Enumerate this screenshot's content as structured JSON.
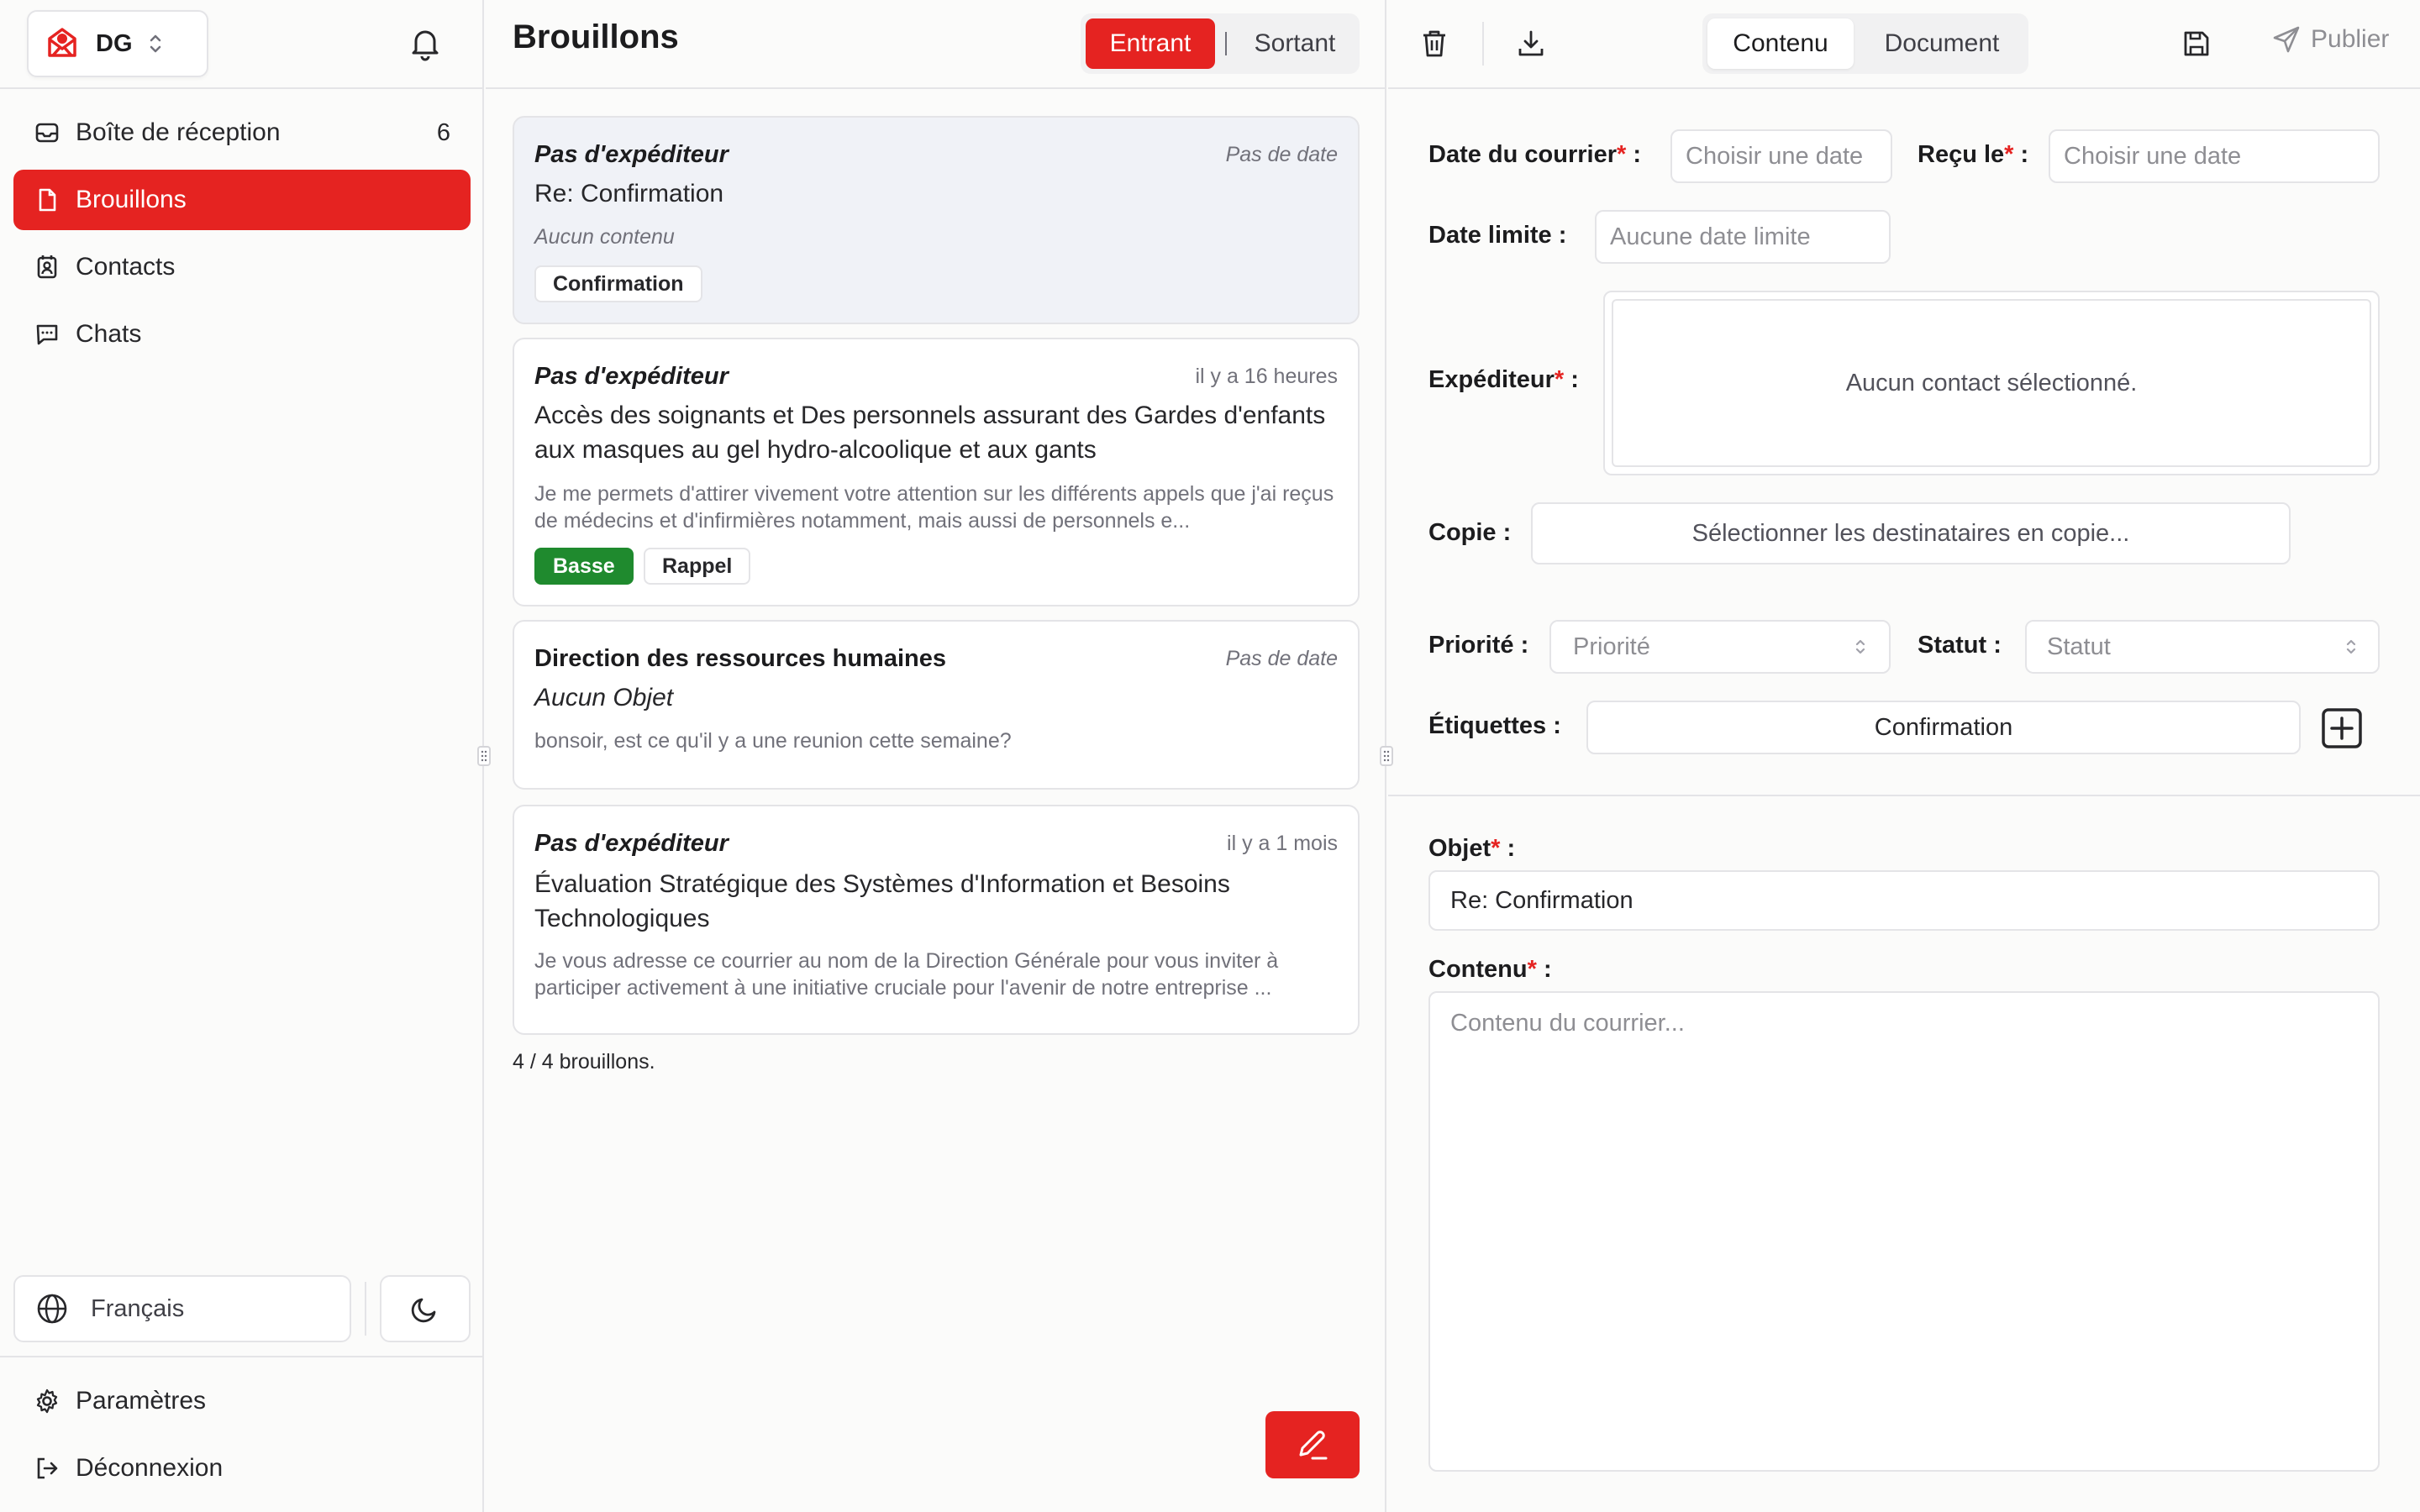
{
  "sidebar": {
    "org": "DG",
    "nav": [
      {
        "label": "Boîte de réception",
        "count": "6"
      },
      {
        "label": "Brouillons"
      },
      {
        "label": "Contacts"
      },
      {
        "label": "Chats"
      }
    ],
    "language": "Français",
    "settings": "Paramètres",
    "logout": "Déconnexion"
  },
  "list": {
    "title": "Brouillons",
    "toggle": {
      "incoming": "Entrant",
      "outgoing": "Sortant"
    },
    "cards": [
      {
        "sender": "Pas d'expéditeur",
        "date": "Pas de date",
        "subject": "Re: Confirmation",
        "preview": "Aucun contenu",
        "tags": [
          "Confirmation"
        ]
      },
      {
        "sender": "Pas d'expéditeur",
        "date": "il y a 16 heures",
        "subject": "Accès des soignants et Des personnels assurant des Gardes d'enfants aux masques au gel hydro-alcoolique et aux gants",
        "preview": "Je me permets d'attirer vivement votre attention sur les différents appels que j'ai reçus de médecins et d'infirmières notamment, mais aussi de personnels e...",
        "tags": [
          "Basse",
          "Rappel"
        ]
      },
      {
        "sender": "Direction des ressources humaines",
        "date": "Pas de date",
        "subject": "Aucun Objet",
        "preview": "bonsoir, est ce qu'il y a une reunion cette semaine?"
      },
      {
        "sender": "Pas d'expéditeur",
        "date": "il y a 1 mois",
        "subject": "Évaluation Stratégique des Systèmes d'Information et Besoins Technologiques",
        "preview": "Je vous adresse ce courrier au nom de la Direction Générale pour vous inviter à participer activement à une initiative cruciale pour l'avenir de notre entreprise ..."
      }
    ],
    "count_text": "4 / 4 brouillons."
  },
  "editor": {
    "tabs": {
      "content": "Contenu",
      "document": "Document"
    },
    "publish": "Publier",
    "fields": {
      "mail_date_label": "Date du courrier",
      "mail_date_placeholder": "Choisir une date",
      "received_label": "Reçu le",
      "received_placeholder": "Choisir une date",
      "deadline_label": "Date limite :",
      "deadline_placeholder": "Aucune date limite",
      "sender_label": "Expéditeur",
      "sender_empty": "Aucun contact sélectionné.",
      "copy_label": "Copie :",
      "copy_placeholder": "Sélectionner les destinataires en copie...",
      "priority_label": "Priorité :",
      "priority_placeholder": "Priorité",
      "status_label": "Statut :",
      "status_placeholder": "Statut",
      "tags_label": "Étiquettes :",
      "tags_value": "Confirmation",
      "subject_label": "Objet",
      "subject_value": "Re: Confirmation",
      "content_label": "Contenu",
      "content_placeholder": "Contenu du courrier..."
    }
  },
  "colors": {
    "accent": "#e52321",
    "low_priority": "#1f8a2e"
  }
}
